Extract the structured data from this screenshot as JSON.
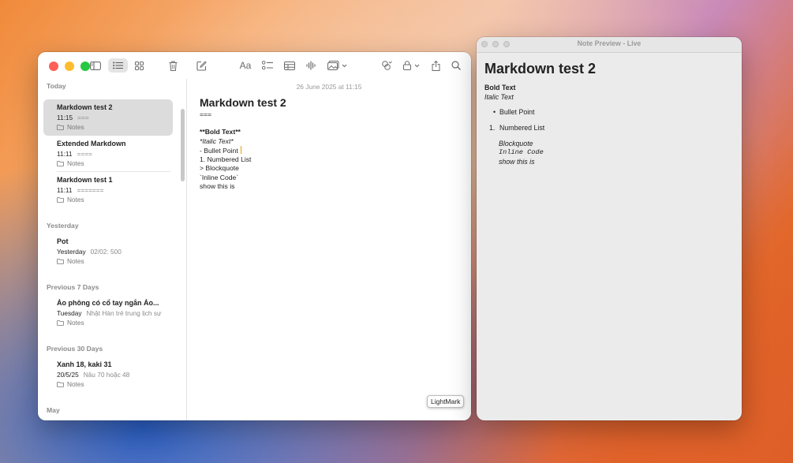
{
  "notes_window": {
    "sidebar": {
      "sections": [
        {
          "title": "Today"
        },
        {
          "title": "Yesterday"
        },
        {
          "title": "Previous 7 Days"
        },
        {
          "title": "Previous 30 Days"
        },
        {
          "title": "May"
        }
      ],
      "notes": [
        {
          "title": "Markdown test 2",
          "time": "11:15",
          "snippet": "===",
          "folder": "Notes",
          "selected": true
        },
        {
          "title": "Extended Markdown",
          "time": "11:11",
          "snippet": "====",
          "folder": "Notes"
        },
        {
          "title": "Markdown test 1",
          "time": "11:11",
          "snippet": "=======",
          "folder": "Notes"
        },
        {
          "title": "Pot",
          "time": "Yesterday",
          "snippet": "02/02: 500",
          "folder": "Notes"
        },
        {
          "title": "Áo phông có cổ tay ngắn Áo...",
          "time": "Tuesday",
          "snippet": "Nhật Hàn trẻ trung lịch sự",
          "folder": "Notes"
        },
        {
          "title": "Xanh 18, kaki 31",
          "time": "20/5/25",
          "snippet": "Nâu 70 hoặc 48",
          "folder": "Notes"
        }
      ]
    },
    "editor": {
      "date": "26 June 2025 at 11:15",
      "title": "Markdown test 2",
      "lines": [
        "===",
        "**Bold Text**",
        "*Italic Text*",
        "- Bullet Point",
        "1. Numbered List",
        "> Blockquote",
        "`Inline Code`",
        "show this is"
      ],
      "tooltip": "LightMark"
    },
    "toolbar_icons": [
      "sidebar-toggle-icon",
      "list-view-icon",
      "gallery-view-icon",
      "trash-icon",
      "compose-icon",
      "text-format-icon",
      "checklist-icon",
      "table-icon",
      "audio-icon",
      "media-icon",
      "collaborate-icon",
      "lock-icon",
      "share-icon",
      "search-icon"
    ]
  },
  "preview_window": {
    "title": "Note Preview - Live",
    "h1": "Markdown test 2",
    "bold": "Bold Text",
    "italic": "Italic Text",
    "bullet": "Bullet Point",
    "numbered_index": "1.",
    "numbered": "Numbered List",
    "blockquote": "Blockquote",
    "inline_code": "Inline Code",
    "trailing": "show this is"
  },
  "colors": {
    "close": "#ff5f57",
    "minimize": "#febc2e",
    "zoom": "#28c840",
    "caret": "#e9a000"
  }
}
